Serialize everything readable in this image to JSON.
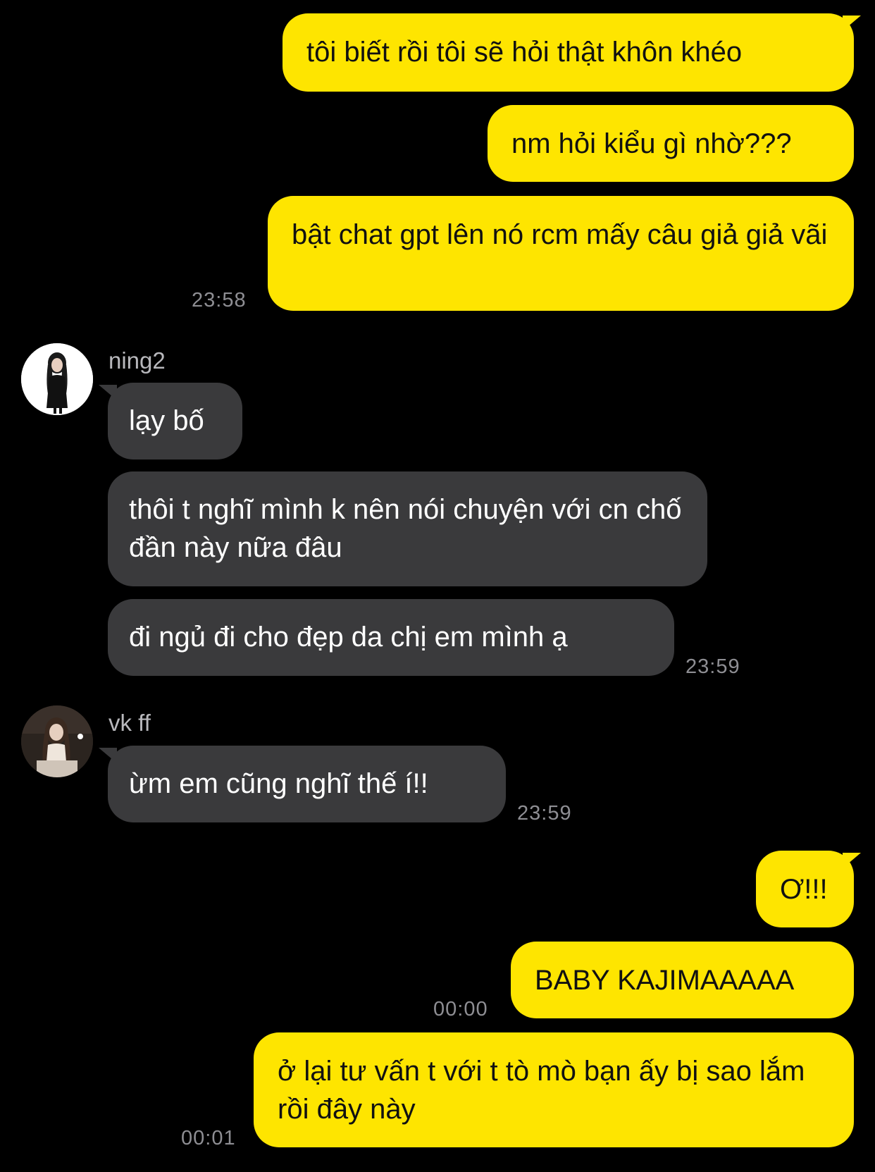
{
  "colors": {
    "background": "#000000",
    "outgoing_bubble": "#FEE500",
    "incoming_bubble": "#3A3A3C",
    "timestamp": "#8E8E93",
    "sender_name": "#B8B8BC"
  },
  "outgoing_group_1": {
    "messages": [
      "tôi biết rồi tôi sẽ hỏi thật khôn khéo",
      "nm hỏi kiểu gì nhờ???",
      "bật chat gpt lên nó rcm mấy câu giả giả vãi"
    ],
    "time": "23:58"
  },
  "incoming_group_1": {
    "sender": "ning2",
    "avatar_icon": "profile-photo-girl-white-bg",
    "messages": [
      "lạy bố",
      "thôi t nghĩ mình k nên nói chuyện với cn chố đần này nữa đâu",
      "đi ngủ đi cho đẹp da chị em mình ạ"
    ],
    "time": "23:59"
  },
  "incoming_group_2": {
    "sender": "vk ff",
    "avatar_icon": "profile-photo-girl-dark-bg",
    "messages": [
      "ừm em cũng nghĩ thế í!!"
    ],
    "time": "23:59"
  },
  "outgoing_group_2": {
    "messages": [
      "Ơ!!!",
      "BABY KAJIMAAAAA",
      "ở lại tư vấn t với t tò mò bạn ấy bị sao lắm rồi đây này"
    ],
    "time_1": "00:00",
    "time_2": "00:01"
  }
}
